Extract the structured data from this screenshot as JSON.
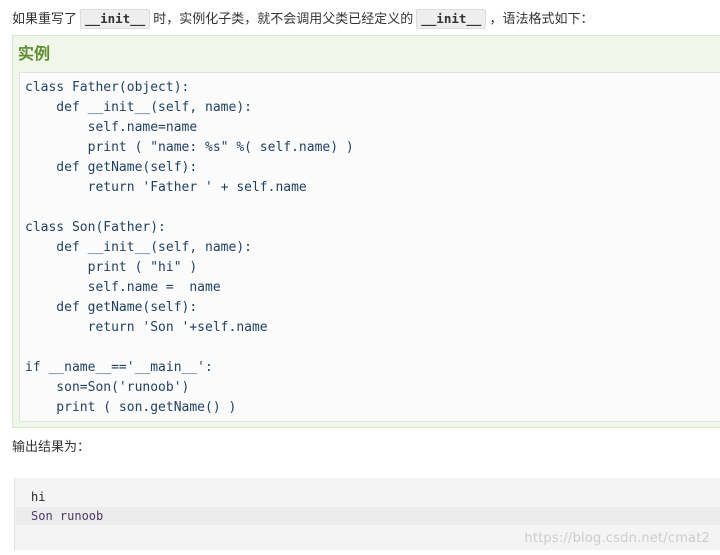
{
  "intro": {
    "prefix": "如果重写了",
    "kw1": "__init__",
    "middle": "时，实例化子类，就不会调用父类已经定义的",
    "kw2": "__init__",
    "suffix": "，语法格式如下："
  },
  "example": {
    "title": "实例",
    "code_lines": [
      "class Father(object):",
      "    def __init__(self, name):",
      "        self.name=name",
      "        print ( \"name: %s\" %( self.name) )",
      "    def getName(self):",
      "        return 'Father ' + self.name",
      "",
      "class Son(Father):",
      "    def __init__(self, name):",
      "        print ( \"hi\" )",
      "        self.name =  name",
      "    def getName(self):",
      "        return 'Son '+self.name",
      "",
      "if __name__=='__main__':",
      "    son=Son('runoob')",
      "    print ( son.getName() )"
    ]
  },
  "output": {
    "label": "输出结果为：",
    "lines": [
      "hi",
      "Son runoob"
    ]
  },
  "watermark": "https://blog.csdn.net/cmat2"
}
